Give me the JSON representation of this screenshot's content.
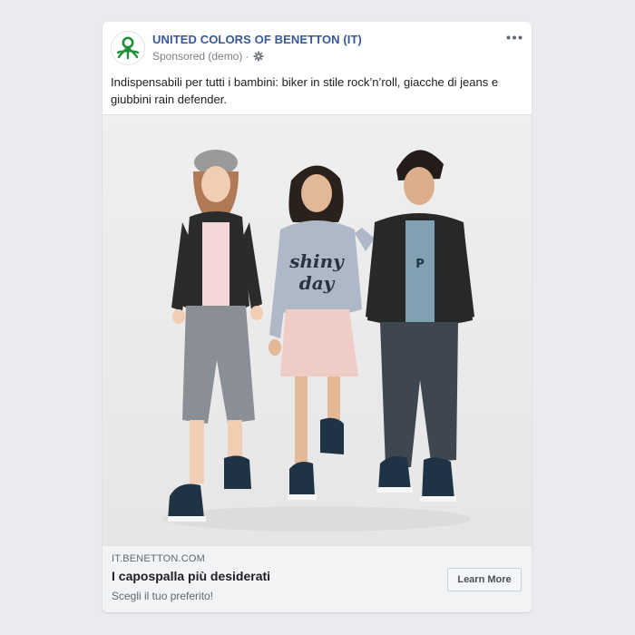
{
  "post": {
    "page_name": "UNITED COLORS OF BENETTON (IT)",
    "sponsored": "Sponsored (demo)",
    "separator": "·",
    "caption": "Indispensabili per tutti i bambini: biker in stile rock’n’roll, giacche di jeans e giubbini rain defender."
  },
  "icons": {
    "logo": "benetton-logo",
    "settings": "gear-icon",
    "more": "more-options-icon"
  },
  "link": {
    "domain": "IT.BENETTON.COM",
    "headline": "I capospalla più desiderati",
    "description": "Scegli il tuo preferito!",
    "cta": "Learn More"
  },
  "colors": {
    "brand_green": "#1f8f3a",
    "page_name": "#385898",
    "background": "#e9ebee"
  }
}
